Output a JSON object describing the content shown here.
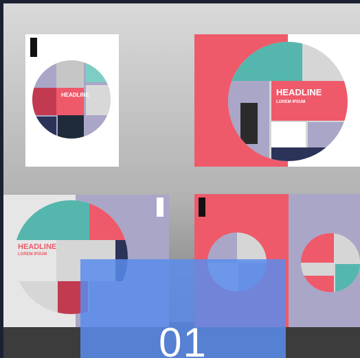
{
  "cards": {
    "number": "01"
  },
  "brochures": {
    "headline": "HEADLINE",
    "subheadline": "LOREM IPSUM"
  }
}
